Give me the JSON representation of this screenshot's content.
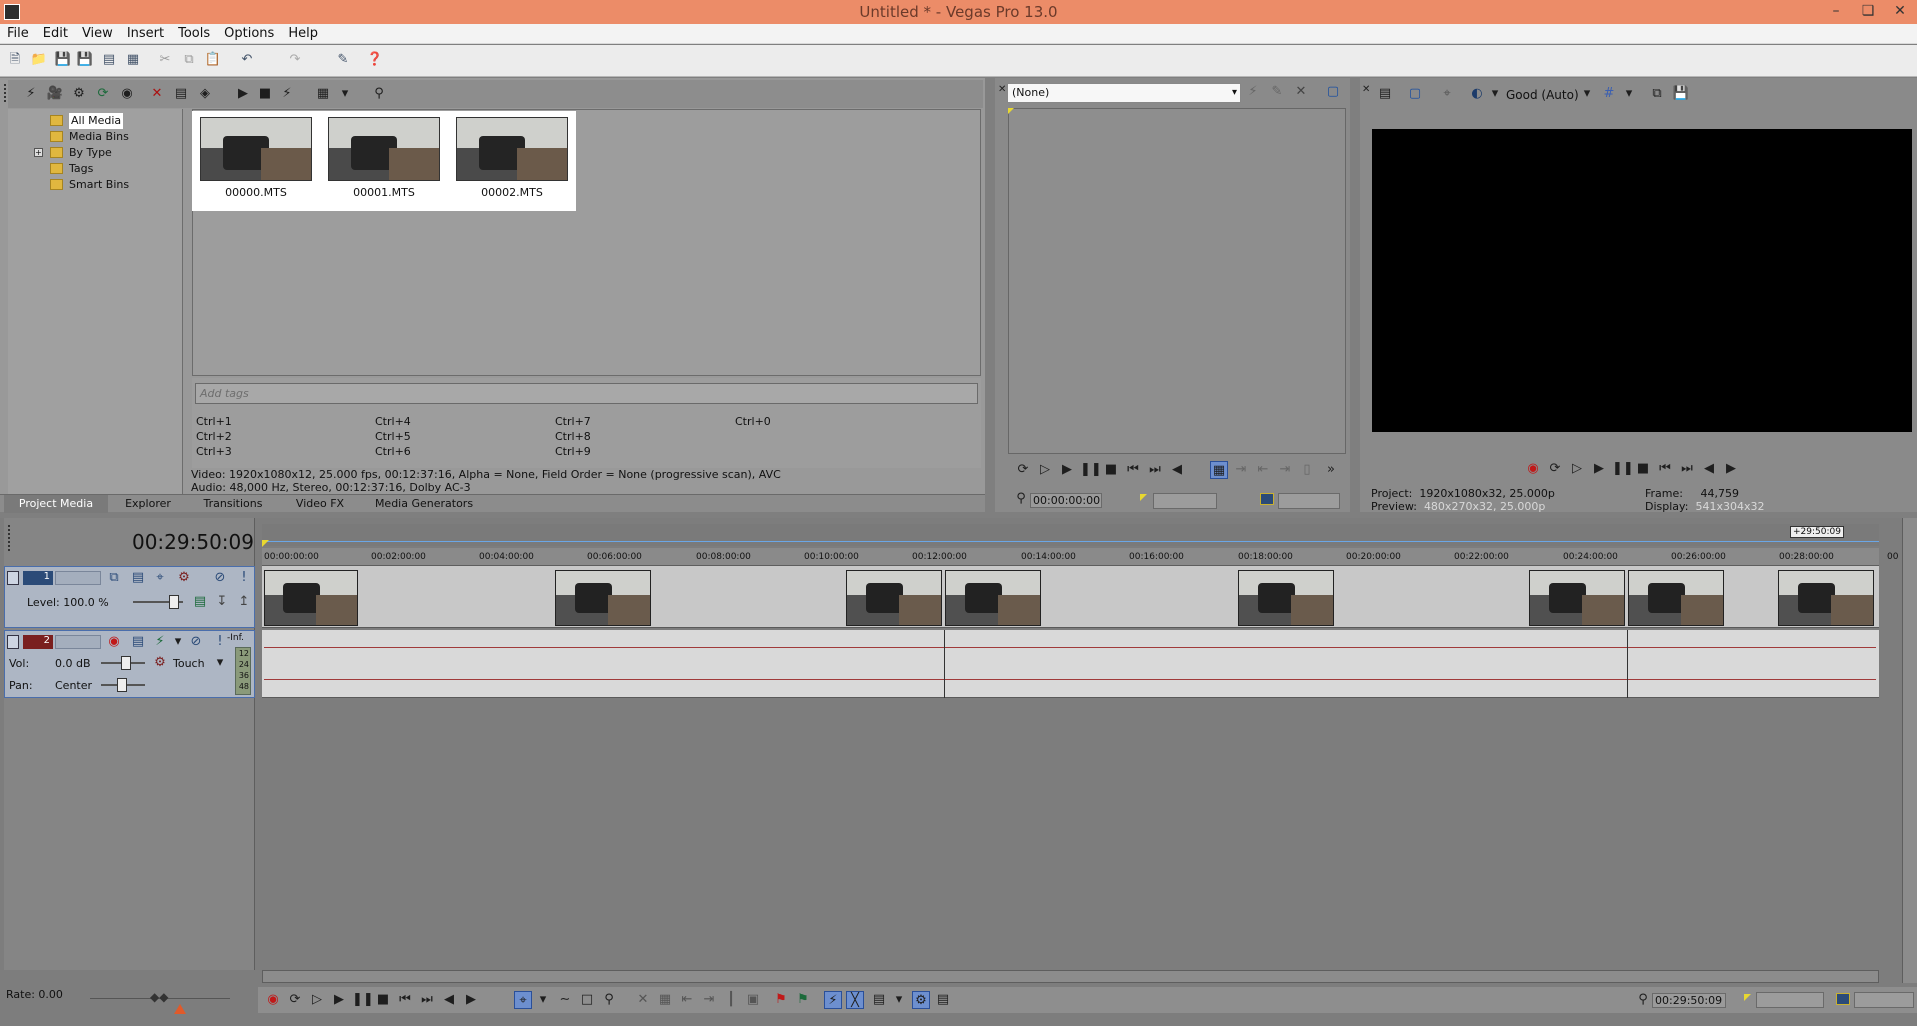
{
  "window": {
    "title": "Untitled * - Vegas Pro 13.0"
  },
  "menu": [
    "File",
    "Edit",
    "View",
    "Insert",
    "Tools",
    "Options",
    "Help"
  ],
  "media_tree": [
    {
      "label": "All Media",
      "selected": true
    },
    {
      "label": "Media Bins"
    },
    {
      "label": "By Type",
      "expand": "+"
    },
    {
      "label": "Tags"
    },
    {
      "label": "Smart Bins"
    }
  ],
  "media_files": [
    "00000.MTS",
    "00001.MTS",
    "00002.MTS"
  ],
  "tags": {
    "placeholder": "Add tags",
    "shortcuts": [
      "Ctrl+1",
      "Ctrl+2",
      "Ctrl+3",
      "Ctrl+4",
      "Ctrl+5",
      "Ctrl+6",
      "Ctrl+7",
      "Ctrl+8",
      "Ctrl+9",
      "Ctrl+0"
    ]
  },
  "media_info": {
    "video": "Video: 1920x1080x12, 25.000 fps, 00:12:37:16, Alpha = None, Field Order = None (progressive scan), AVC",
    "audio": "Audio: 48,000 Hz, Stereo, 00:12:37:16, Dolby AC-3"
  },
  "tabs": [
    "Project Media",
    "Explorer",
    "Transitions",
    "Video FX",
    "Media Generators"
  ],
  "trimmer": {
    "selector": "(None)",
    "timecode": "00:00:00:00"
  },
  "preview": {
    "quality": "Good (Auto)",
    "project_label": "Project:",
    "project_value": "1920x1080x32, 25.000p",
    "preview_label": "Preview:",
    "preview_value": "480x270x32, 25.000p",
    "frame_label": "Frame:",
    "frame_value": "44,759",
    "display_label": "Display:",
    "display_value": "541x304x32"
  },
  "timeline": {
    "timecode": "00:29:50:09",
    "end_marker": "+29:50:09",
    "ruler": [
      "00:00:00:00",
      "00:02:00:00",
      "00:04:00:00",
      "00:06:00:00",
      "00:08:00:00",
      "00:10:00:00",
      "00:12:00:00",
      "00:14:00:00",
      "00:16:00:00",
      "00:18:00:00",
      "00:20:00:00",
      "00:22:00:00",
      "00:24:00:00",
      "00:26:00:00",
      "00:28:00:00",
      "00"
    ],
    "video_track": {
      "number": "1",
      "level_label": "Level: 100.0 %"
    },
    "audio_track": {
      "number": "2",
      "vol_label": "Vol:",
      "vol_value": "0.0 dB",
      "pan_label": "Pan:",
      "pan_value": "Center",
      "mode": "Touch",
      "meter_top": "-Inf.",
      "meter_ticks": [
        "12",
        "24",
        "36",
        "48"
      ]
    }
  },
  "status": {
    "rate": "Rate: 0.00",
    "cursor_time": "00:29:50:09"
  }
}
